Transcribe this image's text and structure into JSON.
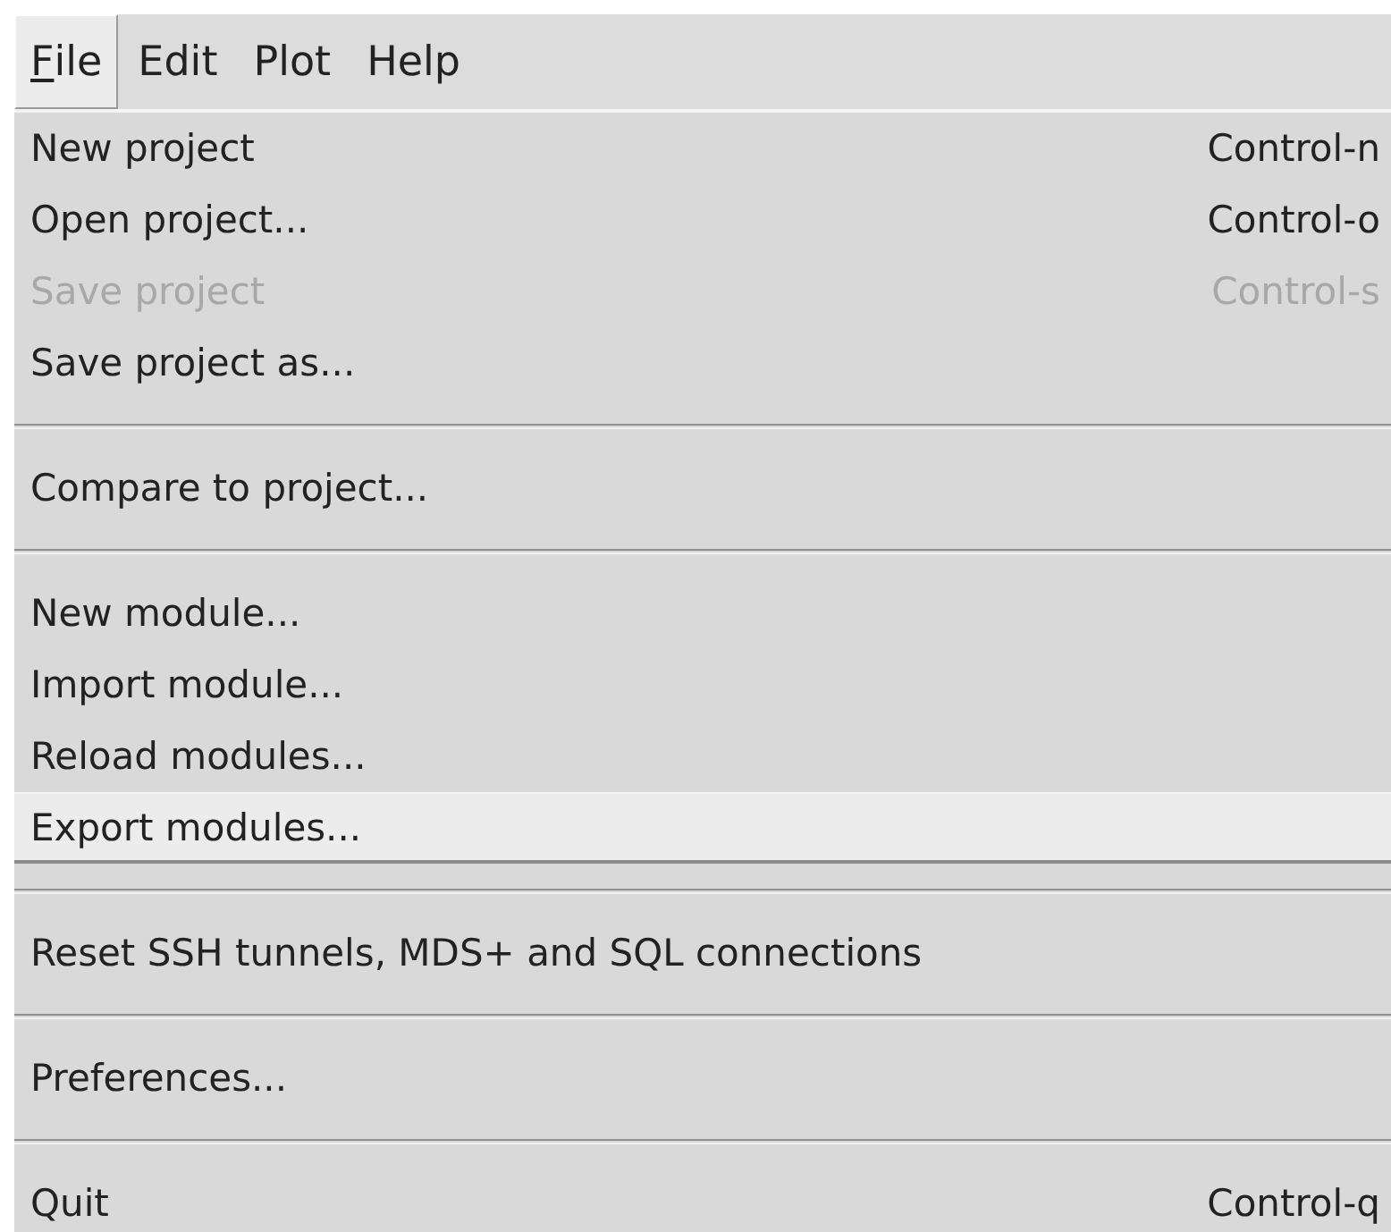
{
  "menubar": [
    {
      "label": "File",
      "selected": true,
      "first_letter_underlined": true
    },
    {
      "label": "Edit",
      "selected": false
    },
    {
      "label": "Plot",
      "selected": false
    },
    {
      "label": "Help",
      "selected": false
    }
  ],
  "menu": [
    {
      "kind": "item",
      "label": "New project",
      "shortcut": "Control-n",
      "disabled": false,
      "selected": false
    },
    {
      "kind": "item",
      "label": "Open project...",
      "shortcut": "Control-o",
      "disabled": false,
      "selected": false
    },
    {
      "kind": "item",
      "label": "Save project",
      "shortcut": "Control-s",
      "disabled": true,
      "selected": false
    },
    {
      "kind": "item",
      "label": "Save project as...",
      "disabled": false,
      "selected": false
    },
    {
      "kind": "separator"
    },
    {
      "kind": "item",
      "label": "Compare to project...",
      "disabled": false,
      "selected": false
    },
    {
      "kind": "separator"
    },
    {
      "kind": "item",
      "label": "New module...",
      "disabled": false,
      "selected": false
    },
    {
      "kind": "item",
      "label": "Import module...",
      "disabled": false,
      "selected": false
    },
    {
      "kind": "item",
      "label": "Reload modules...",
      "disabled": false,
      "selected": false
    },
    {
      "kind": "item",
      "label": "Export modules...",
      "disabled": false,
      "selected": true
    },
    {
      "kind": "separator"
    },
    {
      "kind": "item",
      "label": "Reset SSH tunnels, MDS+ and SQL connections",
      "disabled": false,
      "selected": false
    },
    {
      "kind": "separator"
    },
    {
      "kind": "item",
      "label": "Preferences...",
      "disabled": false,
      "selected": false
    },
    {
      "kind": "separator"
    },
    {
      "kind": "item",
      "label": "Quit",
      "shortcut": "Control-q",
      "disabled": false,
      "selected": false
    }
  ]
}
